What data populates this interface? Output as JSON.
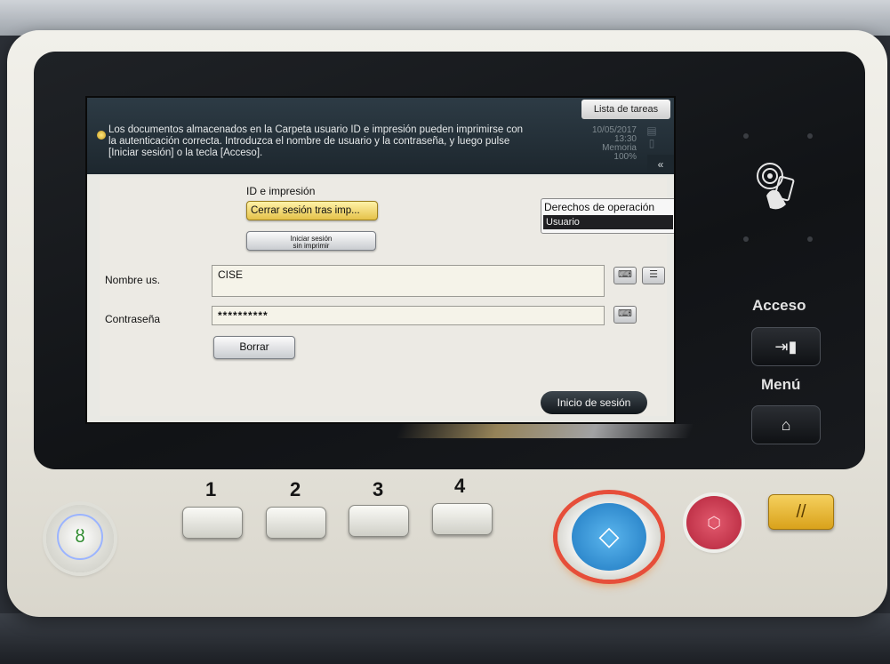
{
  "screen": {
    "message": "Los documentos almacenados en la Carpeta usuario ID e impresión pueden imprimirse con la autenticación correcta. Introduzca el nombre de usuario y la contraseña, y luego pulse [Iniciar sesión] o la tecla [Acceso].",
    "tasks_button": "Lista de tareas",
    "date": "10/05/2017",
    "time": "13:30",
    "memory_label": "Memoria",
    "memory_value": "100%",
    "collapse_icon": "«",
    "id_print_label": "ID e impresión",
    "logout_after_print_button": "Cerrar sesión tras imp...",
    "login_no_print_line1": "Iniciar sesión",
    "login_no_print_line2": "sin imprimir",
    "rights_label": "Derechos de operación",
    "rights_value": "Usuario",
    "username_label": "Nombre us.",
    "username_value": "CISE",
    "password_label": "Contraseña",
    "password_value": "**********",
    "clear_button": "Borrar",
    "login_button": "Inicio de sesión"
  },
  "panel": {
    "access_label": "Acceso",
    "menu_label": "Menú"
  },
  "keys": {
    "numbers": [
      "1",
      "2",
      "3",
      "4"
    ]
  },
  "colors": {
    "screen_bg": "#e9e9e4",
    "message_bar": "#1d272e",
    "yellow_button": "#e5c24a",
    "start_button": "#1d77bf",
    "stop_button": "#b3233a",
    "reset_button": "#d9a21b"
  },
  "icons": {
    "keyboard": "keyboard-icon",
    "address_book": "address-book-icon",
    "nfc": "nfc-card-icon",
    "access": "access-key-icon",
    "home": "home-icon",
    "power": "power-save-icon",
    "start": "start-icon",
    "stop": "stop-icon",
    "reset": "reset-icon"
  }
}
